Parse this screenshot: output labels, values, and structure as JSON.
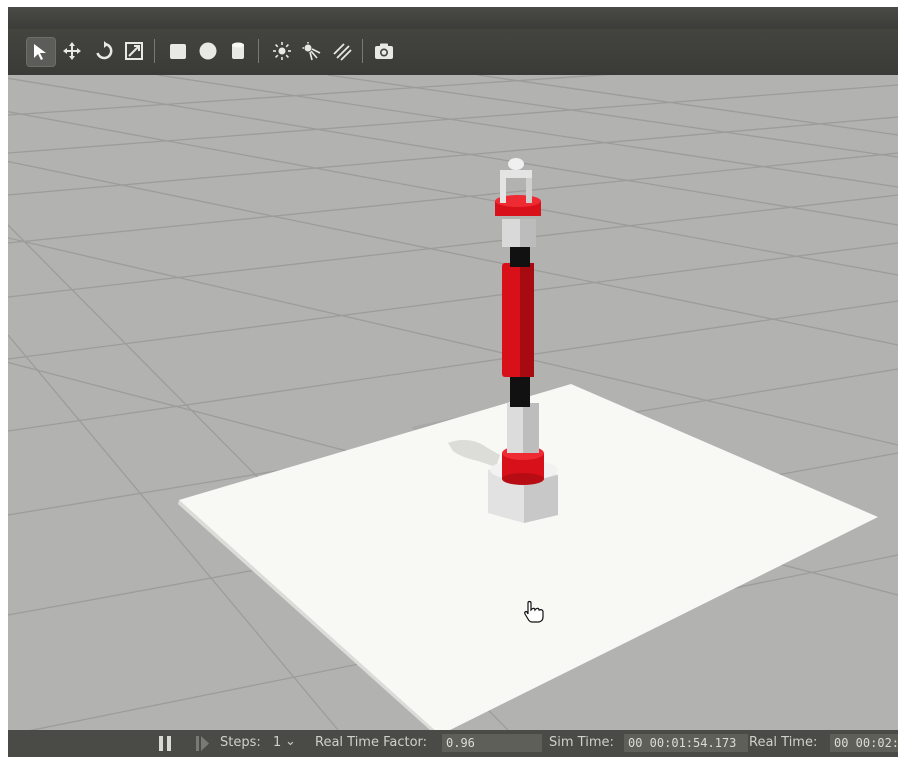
{
  "toolbar": {
    "tools": [
      {
        "name": "select-mode-icon",
        "active": true
      },
      {
        "name": "translate-mode-icon"
      },
      {
        "name": "rotate-mode-icon"
      },
      {
        "name": "scale-mode-icon"
      },
      {
        "name": "box-shape-icon"
      },
      {
        "name": "sphere-shape-icon"
      },
      {
        "name": "cylinder-shape-icon"
      },
      {
        "name": "point-light-icon"
      },
      {
        "name": "spot-light-icon"
      },
      {
        "name": "directional-light-icon"
      },
      {
        "name": "screenshot-icon"
      }
    ]
  },
  "scene": {
    "colors": {
      "ground": "#b2b2b0",
      "grid": "#9d9d9b",
      "platform": "#f8f8f5",
      "robot_red": "#d8101a",
      "robot_white": "#dcdcdc",
      "robot_black": "#111111"
    }
  },
  "status": {
    "steps_label": "Steps:",
    "steps_value": "1",
    "real_time_factor_label": "Real Time Factor:",
    "real_time_factor_value": "0.96",
    "sim_time_label": "Sim Time:",
    "sim_time_value": "00 00:01:54.173",
    "real_time_label": "Real Time:",
    "real_time_value": "00 00:02:"
  }
}
